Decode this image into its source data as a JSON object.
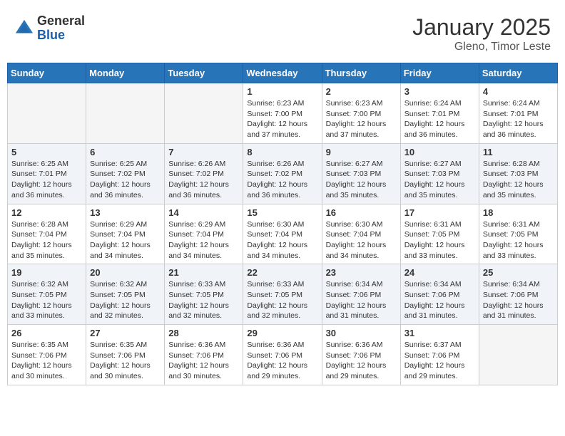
{
  "header": {
    "logo_general": "General",
    "logo_blue": "Blue",
    "month_title": "January 2025",
    "location": "Gleno, Timor Leste"
  },
  "weekdays": [
    "Sunday",
    "Monday",
    "Tuesday",
    "Wednesday",
    "Thursday",
    "Friday",
    "Saturday"
  ],
  "weeks": [
    [
      {
        "day": "",
        "info": ""
      },
      {
        "day": "",
        "info": ""
      },
      {
        "day": "",
        "info": ""
      },
      {
        "day": "1",
        "info": "Sunrise: 6:23 AM\nSunset: 7:00 PM\nDaylight: 12 hours\nand 37 minutes."
      },
      {
        "day": "2",
        "info": "Sunrise: 6:23 AM\nSunset: 7:00 PM\nDaylight: 12 hours\nand 37 minutes."
      },
      {
        "day": "3",
        "info": "Sunrise: 6:24 AM\nSunset: 7:01 PM\nDaylight: 12 hours\nand 36 minutes."
      },
      {
        "day": "4",
        "info": "Sunrise: 6:24 AM\nSunset: 7:01 PM\nDaylight: 12 hours\nand 36 minutes."
      }
    ],
    [
      {
        "day": "5",
        "info": "Sunrise: 6:25 AM\nSunset: 7:01 PM\nDaylight: 12 hours\nand 36 minutes."
      },
      {
        "day": "6",
        "info": "Sunrise: 6:25 AM\nSunset: 7:02 PM\nDaylight: 12 hours\nand 36 minutes."
      },
      {
        "day": "7",
        "info": "Sunrise: 6:26 AM\nSunset: 7:02 PM\nDaylight: 12 hours\nand 36 minutes."
      },
      {
        "day": "8",
        "info": "Sunrise: 6:26 AM\nSunset: 7:02 PM\nDaylight: 12 hours\nand 36 minutes."
      },
      {
        "day": "9",
        "info": "Sunrise: 6:27 AM\nSunset: 7:03 PM\nDaylight: 12 hours\nand 35 minutes."
      },
      {
        "day": "10",
        "info": "Sunrise: 6:27 AM\nSunset: 7:03 PM\nDaylight: 12 hours\nand 35 minutes."
      },
      {
        "day": "11",
        "info": "Sunrise: 6:28 AM\nSunset: 7:03 PM\nDaylight: 12 hours\nand 35 minutes."
      }
    ],
    [
      {
        "day": "12",
        "info": "Sunrise: 6:28 AM\nSunset: 7:04 PM\nDaylight: 12 hours\nand 35 minutes."
      },
      {
        "day": "13",
        "info": "Sunrise: 6:29 AM\nSunset: 7:04 PM\nDaylight: 12 hours\nand 34 minutes."
      },
      {
        "day": "14",
        "info": "Sunrise: 6:29 AM\nSunset: 7:04 PM\nDaylight: 12 hours\nand 34 minutes."
      },
      {
        "day": "15",
        "info": "Sunrise: 6:30 AM\nSunset: 7:04 PM\nDaylight: 12 hours\nand 34 minutes."
      },
      {
        "day": "16",
        "info": "Sunrise: 6:30 AM\nSunset: 7:04 PM\nDaylight: 12 hours\nand 34 minutes."
      },
      {
        "day": "17",
        "info": "Sunrise: 6:31 AM\nSunset: 7:05 PM\nDaylight: 12 hours\nand 33 minutes."
      },
      {
        "day": "18",
        "info": "Sunrise: 6:31 AM\nSunset: 7:05 PM\nDaylight: 12 hours\nand 33 minutes."
      }
    ],
    [
      {
        "day": "19",
        "info": "Sunrise: 6:32 AM\nSunset: 7:05 PM\nDaylight: 12 hours\nand 33 minutes."
      },
      {
        "day": "20",
        "info": "Sunrise: 6:32 AM\nSunset: 7:05 PM\nDaylight: 12 hours\nand 32 minutes."
      },
      {
        "day": "21",
        "info": "Sunrise: 6:33 AM\nSunset: 7:05 PM\nDaylight: 12 hours\nand 32 minutes."
      },
      {
        "day": "22",
        "info": "Sunrise: 6:33 AM\nSunset: 7:05 PM\nDaylight: 12 hours\nand 32 minutes."
      },
      {
        "day": "23",
        "info": "Sunrise: 6:34 AM\nSunset: 7:06 PM\nDaylight: 12 hours\nand 31 minutes."
      },
      {
        "day": "24",
        "info": "Sunrise: 6:34 AM\nSunset: 7:06 PM\nDaylight: 12 hours\nand 31 minutes."
      },
      {
        "day": "25",
        "info": "Sunrise: 6:34 AM\nSunset: 7:06 PM\nDaylight: 12 hours\nand 31 minutes."
      }
    ],
    [
      {
        "day": "26",
        "info": "Sunrise: 6:35 AM\nSunset: 7:06 PM\nDaylight: 12 hours\nand 30 minutes."
      },
      {
        "day": "27",
        "info": "Sunrise: 6:35 AM\nSunset: 7:06 PM\nDaylight: 12 hours\nand 30 minutes."
      },
      {
        "day": "28",
        "info": "Sunrise: 6:36 AM\nSunset: 7:06 PM\nDaylight: 12 hours\nand 30 minutes."
      },
      {
        "day": "29",
        "info": "Sunrise: 6:36 AM\nSunset: 7:06 PM\nDaylight: 12 hours\nand 29 minutes."
      },
      {
        "day": "30",
        "info": "Sunrise: 6:36 AM\nSunset: 7:06 PM\nDaylight: 12 hours\nand 29 minutes."
      },
      {
        "day": "31",
        "info": "Sunrise: 6:37 AM\nSunset: 7:06 PM\nDaylight: 12 hours\nand 29 minutes."
      },
      {
        "day": "",
        "info": ""
      }
    ]
  ]
}
